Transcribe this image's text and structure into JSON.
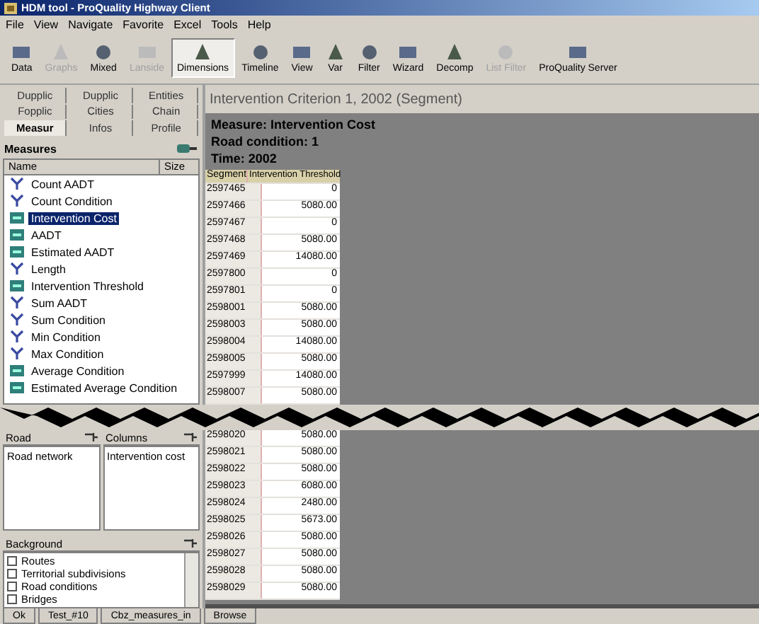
{
  "window": {
    "title": "HDM tool - ProQuality Highway Client"
  },
  "menu": [
    "File",
    "View",
    "Navigate",
    "Favorite",
    "Excel",
    "Tools",
    "Help"
  ],
  "toolbar": [
    {
      "label": "Data",
      "disabled": false,
      "selected": false
    },
    {
      "label": "Graphs",
      "disabled": true,
      "selected": false
    },
    {
      "label": "Mixed",
      "disabled": false,
      "selected": false
    },
    {
      "label": "Lanside",
      "disabled": true,
      "selected": false
    },
    {
      "label": "Dimensions",
      "disabled": false,
      "selected": true
    },
    {
      "label": "Timeline",
      "disabled": false,
      "selected": false
    },
    {
      "label": "View",
      "disabled": false,
      "selected": false
    },
    {
      "label": "Var",
      "disabled": false,
      "selected": false
    },
    {
      "label": "Filter",
      "disabled": false,
      "selected": false
    },
    {
      "label": "Wizard",
      "disabled": false,
      "selected": false
    },
    {
      "label": "Decomp",
      "disabled": false,
      "selected": false
    },
    {
      "label": "List Filter",
      "disabled": true,
      "selected": false
    },
    {
      "label": "ProQuality Server",
      "disabled": false,
      "selected": false
    }
  ],
  "left_tabs": [
    {
      "label": "Dupplic",
      "selected": false
    },
    {
      "label": "Dupplic",
      "selected": false
    },
    {
      "label": "Entities",
      "selected": false
    },
    {
      "label": "Fopplic",
      "selected": false
    },
    {
      "label": "Cities",
      "selected": false
    },
    {
      "label": "Chain",
      "selected": false
    },
    {
      "label": "Measur",
      "selected": true
    },
    {
      "label": "Infos",
      "selected": false
    },
    {
      "label": "Profile",
      "selected": false
    }
  ],
  "measures": {
    "title": "Measures",
    "columns": [
      "Name",
      "Size"
    ],
    "items": [
      {
        "label": "Count AADT",
        "kind": "formula",
        "selected": false
      },
      {
        "label": "Count Condition",
        "kind": "formula",
        "selected": false
      },
      {
        "label": "Intervention Cost",
        "kind": "measure",
        "selected": true
      },
      {
        "label": "AADT",
        "kind": "measure",
        "selected": false
      },
      {
        "label": "Estimated AADT",
        "kind": "measure",
        "selected": false
      },
      {
        "label": "Length",
        "kind": "formula",
        "selected": false
      },
      {
        "label": "Intervention Threshold",
        "kind": "measure",
        "selected": false
      },
      {
        "label": "Sum AADT",
        "kind": "formula",
        "selected": false
      },
      {
        "label": "Sum Condition",
        "kind": "formula",
        "selected": false
      },
      {
        "label": "Min Condition",
        "kind": "formula",
        "selected": false
      },
      {
        "label": "Max Condition",
        "kind": "formula",
        "selected": false
      },
      {
        "label": "Average Condition",
        "kind": "measure",
        "selected": false
      },
      {
        "label": "Estimated Average Condition",
        "kind": "measure",
        "selected": false
      }
    ]
  },
  "view": {
    "title": "Intervention Criterion 1, 2002 (Segment)",
    "info": [
      "Measure: Intervention Cost",
      "Road condition: 1",
      "Time: 2002"
    ],
    "grid": {
      "columns": [
        "Segment",
        "Intervention Threshold"
      ],
      "rows_above": [
        [
          "2597465",
          "0"
        ],
        [
          "2597466",
          "5080.00"
        ],
        [
          "2597467",
          "0"
        ],
        [
          "2597468",
          "5080.00"
        ],
        [
          "2597469",
          "14080.00"
        ],
        [
          "2597800",
          "0"
        ],
        [
          "2597801",
          "0"
        ],
        [
          "2598001",
          "5080.00"
        ],
        [
          "2598003",
          "5080.00"
        ],
        [
          "2598004",
          "14080.00"
        ],
        [
          "2598005",
          "5080.00"
        ],
        [
          "2597999",
          "14080.00"
        ],
        [
          "2598007",
          "5080.00"
        ]
      ],
      "rows_below": [
        [
          "2598020",
          "5080.00"
        ],
        [
          "2598021",
          "5080.00"
        ],
        [
          "2598022",
          "5080.00"
        ],
        [
          "2598023",
          "6080.00"
        ],
        [
          "2598024",
          "2480.00"
        ],
        [
          "2598025",
          "5673.00"
        ],
        [
          "2598026",
          "5080.00"
        ],
        [
          "2598027",
          "5080.00"
        ],
        [
          "2598028",
          "5080.00"
        ],
        [
          "2598029",
          "5080.00"
        ]
      ]
    }
  },
  "panes": [
    {
      "title": "Road",
      "items": [
        "Road network"
      ]
    },
    {
      "title": "Columns",
      "items": [
        "Intervention cost"
      ]
    }
  ],
  "background": {
    "title": "Background",
    "items": [
      {
        "label": "Routes",
        "checked": false
      },
      {
        "label": "Territorial subdivisions",
        "checked": false
      },
      {
        "label": "Road conditions",
        "checked": false
      },
      {
        "label": "Bridges",
        "checked": false
      }
    ]
  },
  "status_bar": [
    "Ok",
    "Test_#10",
    "Cbz_measures_in",
    "Browse"
  ]
}
